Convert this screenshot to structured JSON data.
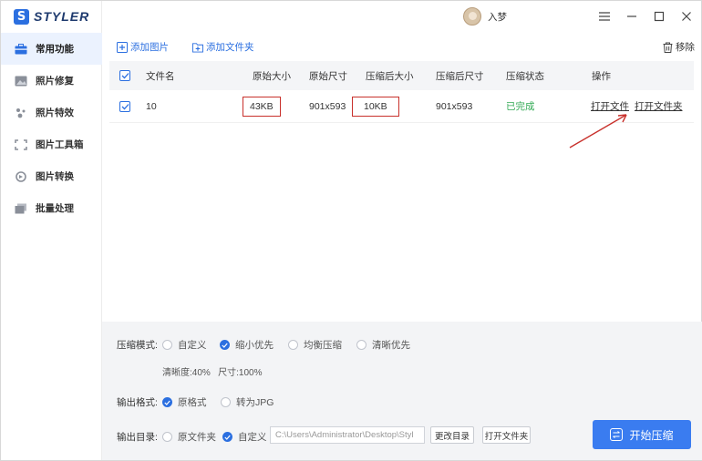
{
  "app": {
    "logo_letter": "S",
    "name": "STYLER"
  },
  "user": {
    "name": "入梦"
  },
  "sidebar": {
    "items": [
      {
        "label": "常用功能",
        "icon": "toolbox-icon",
        "active": true
      },
      {
        "label": "照片修复",
        "icon": "photo-repair-icon",
        "active": false
      },
      {
        "label": "照片特效",
        "icon": "photo-effects-icon",
        "active": false
      },
      {
        "label": "图片工具箱",
        "icon": "image-toolbox-icon",
        "active": false
      },
      {
        "label": "图片转换",
        "icon": "image-convert-icon",
        "active": false
      },
      {
        "label": "批量处理",
        "icon": "batch-process-icon",
        "active": false
      }
    ]
  },
  "toolbar": {
    "add_image": "添加图片",
    "add_folder": "添加文件夹",
    "remove": "移除"
  },
  "table": {
    "headers": {
      "filename": "文件名",
      "orig_size": "原始大小",
      "orig_dim": "原始尺寸",
      "comp_size": "压缩后大小",
      "comp_dim": "压缩后尺寸",
      "status": "压缩状态",
      "actions": "操作"
    },
    "rows": [
      {
        "filename": "10",
        "orig_size": "43KB",
        "orig_dim": "901x593",
        "comp_size": "10KB",
        "comp_dim": "901x593",
        "status": "已完成",
        "open_file": "打开文件",
        "open_folder": "打开文件夹"
      }
    ]
  },
  "settings": {
    "mode_label": "压缩模式:",
    "modes": [
      "自定义",
      "缩小优先",
      "均衡压缩",
      "清晰优先"
    ],
    "selected_mode": "缩小优先",
    "hint": "清晰度:40%   尺寸:100%",
    "format_label": "输出格式:",
    "formats": [
      "原格式",
      "转为JPG"
    ],
    "selected_format": "原格式",
    "dir_label": "输出目录:",
    "dirs": [
      "原文件夹",
      "自定义"
    ],
    "selected_dir": "自定义",
    "path": "C:\\Users\\Administrator\\Desktop\\Styl",
    "change_dir": "更改目录",
    "open_folder": "打开文件夹",
    "start": "开始压缩"
  },
  "colors": {
    "accent": "#2b6fe0",
    "done": "#33aa55",
    "highlight": "#c8302b"
  }
}
